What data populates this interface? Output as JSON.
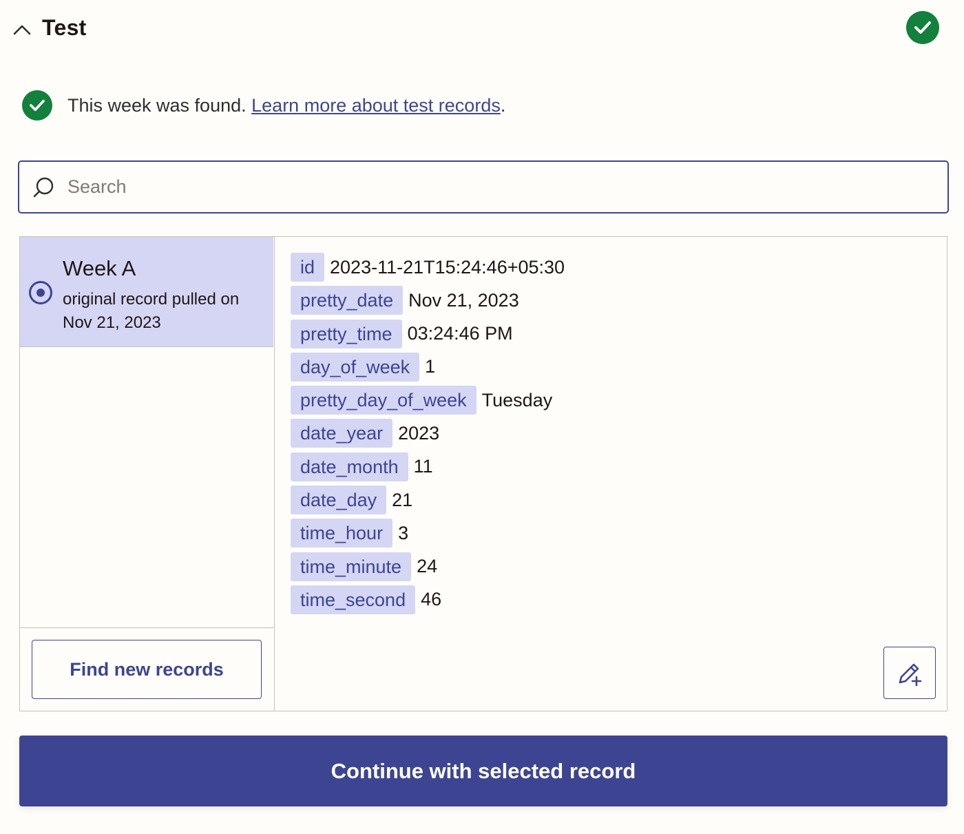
{
  "header": {
    "title": "Test",
    "collapse_icon": "chevron-up-icon",
    "status_icon": "check-circle-icon"
  },
  "notice": {
    "text": "This week was found. ",
    "link_text": "Learn more about test records",
    "suffix": ".",
    "icon": "check-circle-icon"
  },
  "search": {
    "placeholder": "Search",
    "value": "",
    "icon": "search-icon"
  },
  "records": [
    {
      "title": "Week A",
      "subtitle": "original record pulled on Nov 21, 2023",
      "selected": true
    }
  ],
  "find_button_label": "Find new records",
  "fields": [
    {
      "key": "id",
      "value": "2023-11-21T15:24:46+05:30"
    },
    {
      "key": "pretty_date",
      "value": "Nov 21, 2023"
    },
    {
      "key": "pretty_time",
      "value": "03:24:46 PM"
    },
    {
      "key": "day_of_week",
      "value": "1"
    },
    {
      "key": "pretty_day_of_week",
      "value": "Tuesday"
    },
    {
      "key": "date_year",
      "value": "2023"
    },
    {
      "key": "date_month",
      "value": "11"
    },
    {
      "key": "date_day",
      "value": "21"
    },
    {
      "key": "time_hour",
      "value": "3"
    },
    {
      "key": "time_minute",
      "value": "24"
    },
    {
      "key": "time_second",
      "value": "46"
    }
  ],
  "edit_icon": "pencil-plus-icon",
  "continue_button_label": "Continue with selected record",
  "colors": {
    "accent": "#3d4592",
    "success": "#13803d",
    "highlight": "#d4d6f4",
    "background": "#fffdf9",
    "border": "#c5c0b9"
  }
}
